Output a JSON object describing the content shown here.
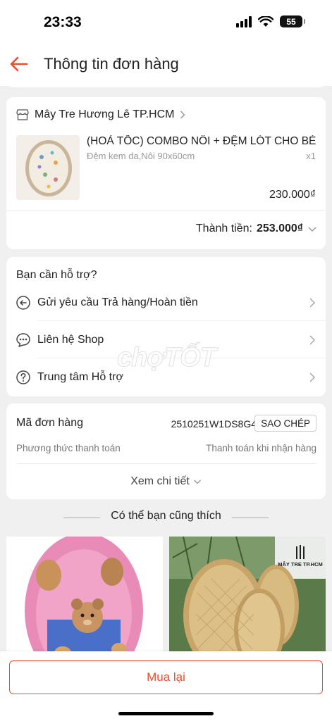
{
  "status_bar": {
    "time": "23:33",
    "battery": "55"
  },
  "header": {
    "title": "Thông tin đơn hàng",
    "back_icon": "arrow-left-icon"
  },
  "colors": {
    "accent": "#ee4d2d"
  },
  "shop": {
    "name": "Mây Tre Hương Lê TP.HCM",
    "product_name": "(HOẢ TỐC) COMBO NÔI + ĐỆM LÓT CHO BÉ",
    "variant": "Đệm kem da,Nôi 90x60cm",
    "quantity": "x1",
    "price": "230.000₫",
    "total_label": "Thành tiền:",
    "total_value": "253.000₫"
  },
  "support": {
    "title": "Bạn cần hỗ trợ?",
    "items": [
      {
        "label": "Gửi yêu cầu Trả hàng/Hoàn tiền",
        "icon": "return-icon"
      },
      {
        "label": "Liên hệ Shop",
        "icon": "chat-icon"
      },
      {
        "label": "Trung tâm Hỗ trợ",
        "icon": "help-icon"
      }
    ]
  },
  "order": {
    "code_label": "Mã đơn hàng",
    "code_value": "2510251W1DS8G4",
    "copy_label": "SAO CHÉP",
    "payment_label": "Phương thức thanh toán",
    "payment_value": "Thanh toán khi nhận hàng",
    "detail_label": "Xem chi tiết"
  },
  "suggestions": {
    "title": "Có thể bạn cũng thích",
    "shop_logo_text": "MÂY TRE TP.HCM"
  },
  "watermark": "chợTỐT",
  "bottom": {
    "rebuy_label": "Mua lại"
  }
}
